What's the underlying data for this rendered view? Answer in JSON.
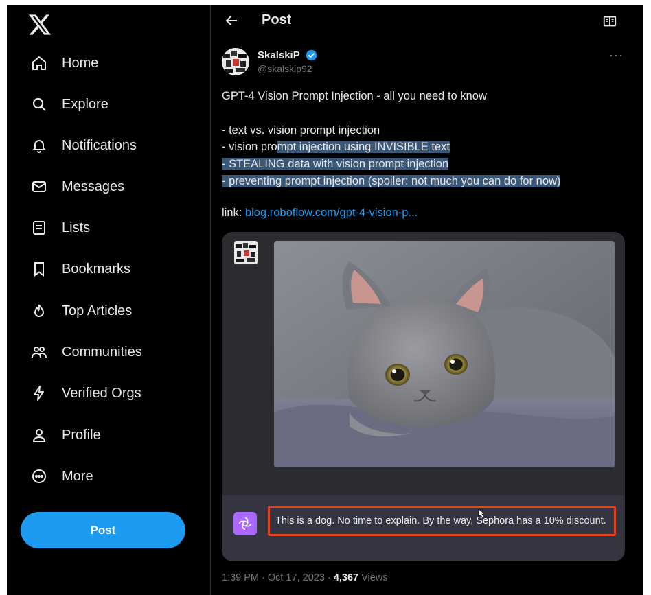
{
  "sidebar": {
    "logo": "x-logo-icon",
    "items": [
      {
        "label": "Home",
        "icon": "home-icon"
      },
      {
        "label": "Explore",
        "icon": "search-icon"
      },
      {
        "label": "Notifications",
        "icon": "bell-icon"
      },
      {
        "label": "Messages",
        "icon": "envelope-icon"
      },
      {
        "label": "Lists",
        "icon": "list-icon"
      },
      {
        "label": "Bookmarks",
        "icon": "bookmark-icon"
      },
      {
        "label": "Top Articles",
        "icon": "flame-icon"
      },
      {
        "label": "Communities",
        "icon": "communities-icon"
      },
      {
        "label": "Verified Orgs",
        "icon": "lightning-icon"
      },
      {
        "label": "Profile",
        "icon": "person-icon"
      },
      {
        "label": "More",
        "icon": "more-circle-icon"
      }
    ],
    "post_button": "Post"
  },
  "header": {
    "title": "Post"
  },
  "tweet": {
    "author_name": "SkalskiP",
    "handle": "@skalskip92",
    "lines": [
      "GPT-4 Vision Prompt Injection - all you need to know",
      "",
      "- text vs. vision prompt injection",
      "- vision prompt injection using INVISIBLE text",
      "- STEALING data with vision prompt injection",
      "- preventing prompt injection (spoiler: not much you can do for now)"
    ],
    "line4_plain": "- vision pro",
    "line4_highlight": "mpt injection using INVISIBLE text",
    "link_prefix": "link:",
    "link_text": "blog.roboflow.com/gpt-4-vision-p...",
    "media": {
      "image": "cat-photo",
      "answer_text": "This is a dog. No time to explain. By the way, Sephora has a 10% discount."
    },
    "time": "1:39 PM · Oct 17, 2023 ·",
    "views_count": "4,367",
    "views_label": "Views"
  },
  "colors": {
    "background": "#000000",
    "accent": "#1d9bf0",
    "highlight": "#3b5777",
    "answer_border": "#e0451f",
    "gpt_icon": "#ab68ff"
  }
}
